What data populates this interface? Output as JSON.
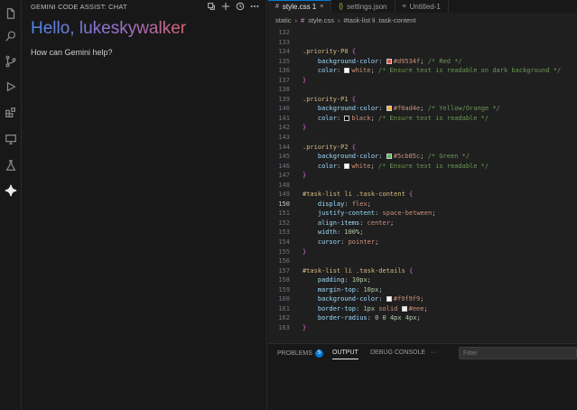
{
  "activity_bar": {
    "icons": [
      "files-icon",
      "search-icon",
      "source-control-icon",
      "run-debug-icon",
      "extensions-icon",
      "remote-explorer-icon",
      "testing-icon",
      "gemini-icon"
    ]
  },
  "chat": {
    "title": "GEMINI CODE ASSIST: CHAT",
    "greeting": "Hello, lukeskywalker",
    "prompt": "How can Gemini help?"
  },
  "tabs": [
    {
      "label": "style.css 1",
      "icon": "#",
      "active": true
    },
    {
      "label": "settings.json",
      "icon": "{}",
      "active": false
    },
    {
      "label": "Untitled-1",
      "icon": "≡",
      "active": false
    }
  ],
  "breadcrumb": [
    "static",
    "style.css",
    "#task-list li .task-content"
  ],
  "code": {
    "current_line": "150",
    "lines": [
      {
        "n": "132",
        "t": ""
      },
      {
        "n": "133",
        "t": ""
      },
      {
        "n": "134",
        "t": ".priority-P0 {"
      },
      {
        "n": "135",
        "t": "    background-color: #d9534f; /* Red */"
      },
      {
        "n": "136",
        "t": "    color: white; /* Ensure text is readable on dark background */"
      },
      {
        "n": "137",
        "t": "}"
      },
      {
        "n": "138",
        "t": ""
      },
      {
        "n": "139",
        "t": ".priority-P1 {"
      },
      {
        "n": "140",
        "t": "    background-color: #f0ad4e; /* Yellow/Orange */"
      },
      {
        "n": "141",
        "t": "    color: black; /* Ensure text is readable */"
      },
      {
        "n": "142",
        "t": "}"
      },
      {
        "n": "143",
        "t": ""
      },
      {
        "n": "144",
        "t": ".priority-P2 {"
      },
      {
        "n": "145",
        "t": "    background-color: #5cb85c; /* Green */"
      },
      {
        "n": "146",
        "t": "    color: white; /* Ensure text is readable */"
      },
      {
        "n": "147",
        "t": "}"
      },
      {
        "n": "148",
        "t": ""
      },
      {
        "n": "149",
        "t": "#task-list li .task-content {"
      },
      {
        "n": "150",
        "t": "    display: flex;"
      },
      {
        "n": "151",
        "t": "    justify-content: space-between;"
      },
      {
        "n": "152",
        "t": "    align-items: center;"
      },
      {
        "n": "153",
        "t": "    width: 100%;"
      },
      {
        "n": "154",
        "t": "    cursor: pointer;"
      },
      {
        "n": "155",
        "t": "}"
      },
      {
        "n": "156",
        "t": ""
      },
      {
        "n": "157",
        "t": "#task-list li .task-details {"
      },
      {
        "n": "158",
        "t": "    padding: 10px;"
      },
      {
        "n": "159",
        "t": "    margin-top: 10px;"
      },
      {
        "n": "160",
        "t": "    background-color: #f9f9f9;"
      },
      {
        "n": "161",
        "t": "    border-top: 1px solid #eee;"
      },
      {
        "n": "162",
        "t": "    border-radius: 0 0 4px 4px;"
      },
      {
        "n": "163",
        "t": "}"
      }
    ],
    "colors": {
      "#d9534f": "#d9534f",
      "white": "#ffffff",
      "#f0ad4e": "#f0ad4e",
      "black": "#000000",
      "#5cb85c": "#5cb85c",
      "#f9f9f9": "#f9f9f9",
      "#eee": "#eeeeee"
    }
  },
  "panel": {
    "tabs": [
      {
        "label": "PROBLEMS",
        "badge": "5"
      },
      {
        "label": "OUTPUT",
        "active": true
      },
      {
        "label": "DEBUG CONSOLE"
      },
      {
        "label": "···"
      }
    ],
    "filter_placeholder": "Filter"
  }
}
